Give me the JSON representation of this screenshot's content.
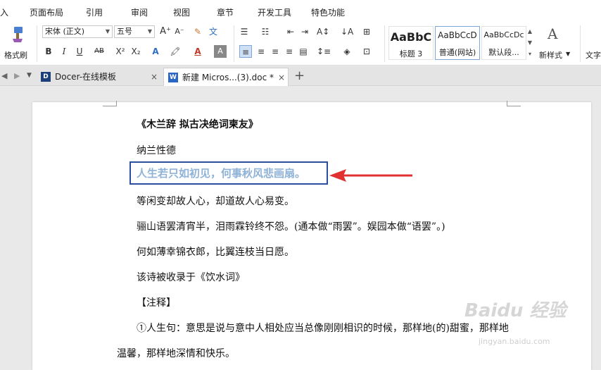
{
  "menu": {
    "items": [
      "入",
      "页面布局",
      "引用",
      "审阅",
      "视图",
      "章节",
      "开发工具",
      "特色功能"
    ]
  },
  "ribbon": {
    "format_painter": "格式刷",
    "font_name": "宋体 (正文)",
    "font_size": "五号",
    "styles": [
      {
        "preview": "AaBbC",
        "name": "标题 3"
      },
      {
        "preview": "AaBbCcD",
        "name": "普通(网站)"
      },
      {
        "preview": "AaBbCcDc",
        "name": "默认段..."
      }
    ],
    "new_style": "新样式",
    "text_tools": "文字"
  },
  "tabs": [
    {
      "title": "Docer-在线模板",
      "icon": "D"
    },
    {
      "title": "新建 Micros...(3).doc *",
      "icon": "W"
    }
  ],
  "document": {
    "title": "《木兰辞 拟古决绝词柬友》",
    "author": "纳兰性德",
    "highlight": "人生若只如初见，何事秋风悲画扇。",
    "line1": "等闲变却故人心，却道故人心易变。",
    "line2": "骊山语罢清宵半，泪雨霖铃终不怨。(通本做“雨罢”。娱园本做“语罢”。)",
    "line3": "何如薄幸锦衣郎，比翼连枝当日愿。",
    "line4": "该诗被收录于《饮水词》",
    "note_head": "【注释】",
    "note1": "①人生句：意思是说与意中人相处应当总像刚刚相识的时候，那样地(的)甜蜜，那样地",
    "note1b": "温馨，那样地深情和快乐。"
  },
  "watermark": {
    "text": "Baidu 经验",
    "url": "jingyan.baidu.com"
  },
  "colors": {
    "highlight_text": "#8fb3d6",
    "highlight_box": "#2b4ea0",
    "arrow": "#e03030",
    "tab_icon": "#1e4f9e"
  }
}
